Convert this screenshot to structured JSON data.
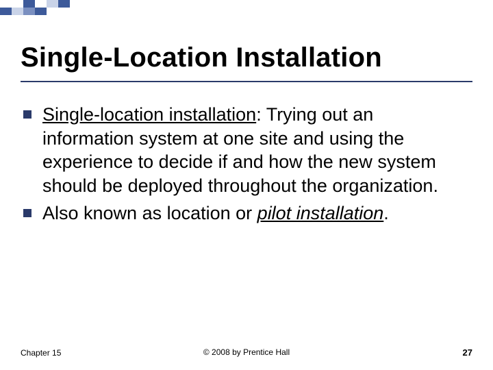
{
  "title": "Single-Location Installation",
  "bullets": [
    {
      "lead_underlined": "Single-location installation",
      "rest": ": Trying out an information system at one site and using the experience to decide if and how the new system should be deployed throughout the organization."
    },
    {
      "plain_prefix": "Also known as location or ",
      "tail_underlined_italic": "pilot installation",
      "tail_suffix": "."
    }
  ],
  "footer": {
    "left": "Chapter 15",
    "center": "© 2008 by Prentice Hall",
    "right": "27"
  }
}
